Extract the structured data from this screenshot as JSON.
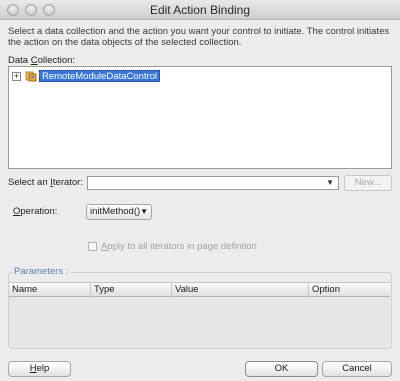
{
  "window": {
    "title": "Edit Action Binding"
  },
  "description": "Select a data collection and the action you want your control to initiate. The control initiates the action on the data objects of the selected collection.",
  "data_collection": {
    "label_prefix": "Data ",
    "label_mnemonic": "C",
    "label_suffix": "ollection:",
    "tree": [
      {
        "label": "RemoteModuleDataControl",
        "expanded": false,
        "selected": true
      }
    ]
  },
  "iterator": {
    "label_prefix": "Select an ",
    "label_mnemonic": "I",
    "label_suffix": "terator:",
    "value": "",
    "new_button": "New..."
  },
  "operation": {
    "label_prefix": "",
    "label_mnemonic": "O",
    "label_suffix": "peration:",
    "value": "initMethod()"
  },
  "apply_all": {
    "label_mnemonic": "A",
    "label_suffix": "pply to all iterators in page defintion",
    "checked": false,
    "enabled": false
  },
  "parameters": {
    "title": "Parameters :",
    "columns": [
      "Name",
      "Type",
      "Value",
      "Option"
    ],
    "rows": []
  },
  "buttons": {
    "help_mnemonic": "H",
    "help_suffix": "elp",
    "ok": "OK",
    "cancel": "Cancel"
  },
  "colors": {
    "selection": "#3875d7",
    "group_title": "#5a7fb0"
  }
}
